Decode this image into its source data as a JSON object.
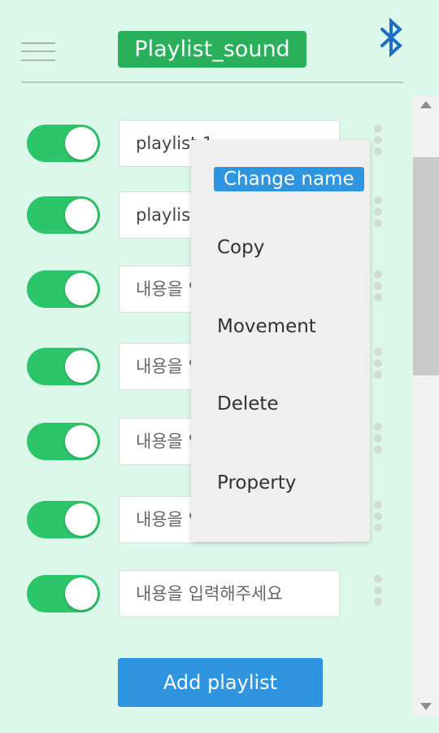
{
  "header": {
    "title": "Playlist_sound",
    "menu_icon": "hamburger-icon",
    "bluetooth_icon": "bluetooth-icon",
    "accent_color": "#2aaf5b",
    "bluetooth_color": "#1f6fc0"
  },
  "playlists": [
    {
      "enabled": true,
      "value": "playlist 1",
      "placeholder": "내용을 입력해주세요"
    },
    {
      "enabled": true,
      "value": "playlist 2",
      "placeholder": "내용을 입력해주세요"
    },
    {
      "enabled": true,
      "value": "",
      "placeholder": "내용을 입력해주세요"
    },
    {
      "enabled": true,
      "value": "",
      "placeholder": "내용을 입력해주세요"
    },
    {
      "enabled": true,
      "value": "",
      "placeholder": "내용을 입력해주세요"
    },
    {
      "enabled": true,
      "value": "",
      "placeholder": "내용을 입력해주세요"
    },
    {
      "enabled": true,
      "value": "",
      "placeholder": "내용을 입력해주세요"
    }
  ],
  "context_menu": {
    "items": [
      "Change name",
      "Copy",
      "Movement",
      "Delete",
      "Property"
    ],
    "selected_index": 0,
    "selected_color": "#2f95e0"
  },
  "footer": {
    "add_label": "Add playlist",
    "button_color": "#2f95e0"
  }
}
